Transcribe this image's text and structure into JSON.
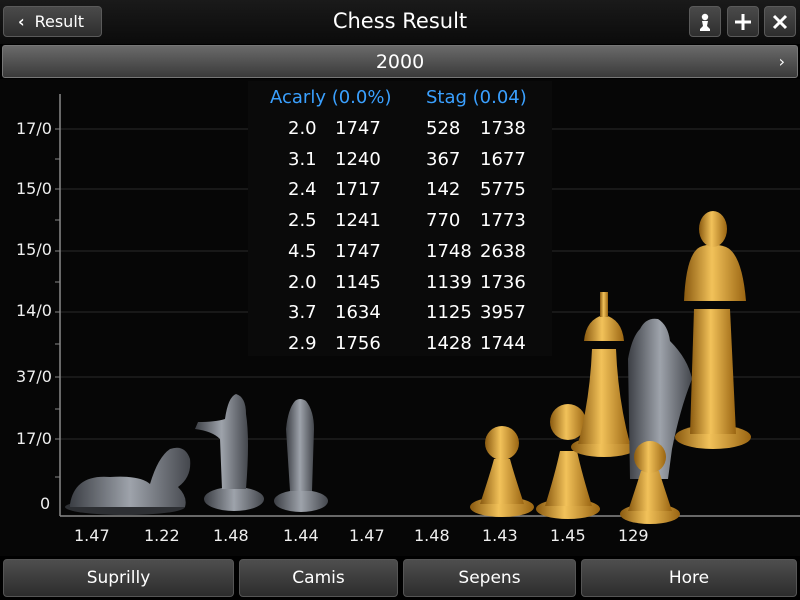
{
  "header": {
    "back_label": "Result",
    "title": "Chess Result",
    "icons": [
      "pawn-icon",
      "plus-icon",
      "close-icon"
    ]
  },
  "yearbar": {
    "year": "2000"
  },
  "chart": {
    "y_ticks": [
      "17/0",
      "15/0",
      "15/0",
      "14/0",
      "37/0",
      "17/0",
      "0"
    ],
    "x_ticks": [
      "1.47",
      "1.22",
      "1.48",
      "1.44",
      "1.47",
      "1.48",
      "1.43",
      "1.45",
      "129"
    ]
  },
  "table": {
    "col1_header": "Acarly (0.0%)",
    "col2_header": "Stag (0.04)",
    "rows": [
      [
        "2.0",
        "1747",
        "528",
        "1738"
      ],
      [
        "3.1",
        "1240",
        "367",
        "1677"
      ],
      [
        "2.4",
        "1717",
        "142",
        "5775"
      ],
      [
        "2.5",
        "1241",
        "770",
        "1773"
      ],
      [
        "4.5",
        "1747",
        "1748",
        "2638"
      ],
      [
        "2.0",
        "1145",
        "1139",
        "1736"
      ],
      [
        "3.7",
        "1634",
        "1125",
        "3957"
      ],
      [
        "2.9",
        "1756",
        "1428",
        "1744"
      ]
    ]
  },
  "bottom_buttons": [
    "Suprilly",
    "Camis",
    "Sepens",
    "Hore"
  ],
  "colors": {
    "accent": "#3aa0ff",
    "gold": "#d4a02a",
    "silver": "#8a8e96"
  }
}
